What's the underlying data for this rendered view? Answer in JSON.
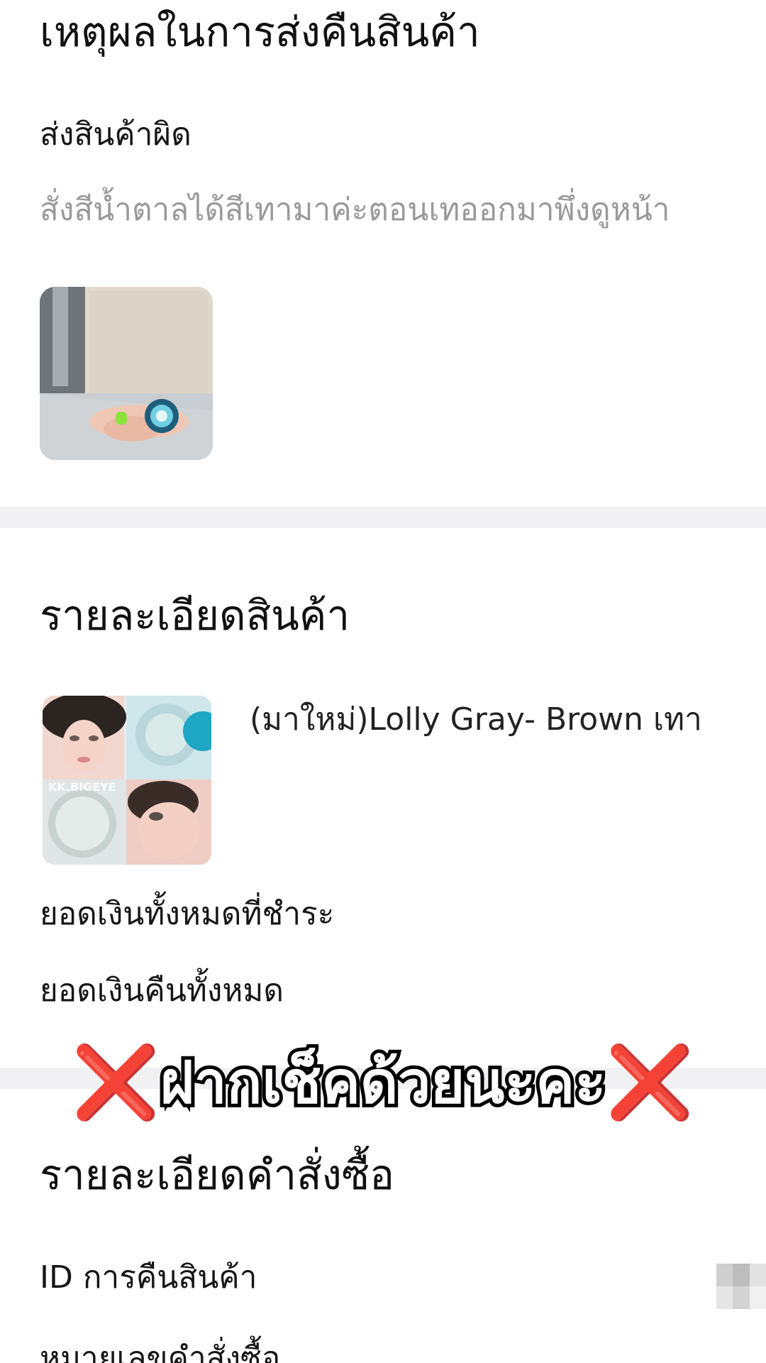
{
  "return_reason": {
    "title": "เหตุผลในการส่งคืนสินค้า",
    "reason": "ส่งสินค้าผิด",
    "description": "สั่งสีน้ำตาลได้สีเทามาค่ะตอนเทออกมาพึ่งดูหน้า"
  },
  "product_details": {
    "title": "รายละเอียดสินค้า",
    "product_name": "(มาใหม่)Lolly Gray- Brown เทา",
    "total_paid_label": "ยอดเงินทั้งหมดที่ชำระ",
    "total_refund_label": "ยอดเงินคืนทั้งหมด"
  },
  "overlay": {
    "text": "ฝากเช็คด้วยนะคะ",
    "mark": "❌"
  },
  "order_details": {
    "title": "รายละเอียดคำสั่งซื้อ",
    "return_id_label": "ID การคืนสินค้า",
    "order_number_label": "หมายเลขคำสั่งซื้อ"
  },
  "colors": {
    "divider": "#f1f1f3",
    "muted_text": "#9a9a9a",
    "overlay_mark": "#d60f0f"
  }
}
